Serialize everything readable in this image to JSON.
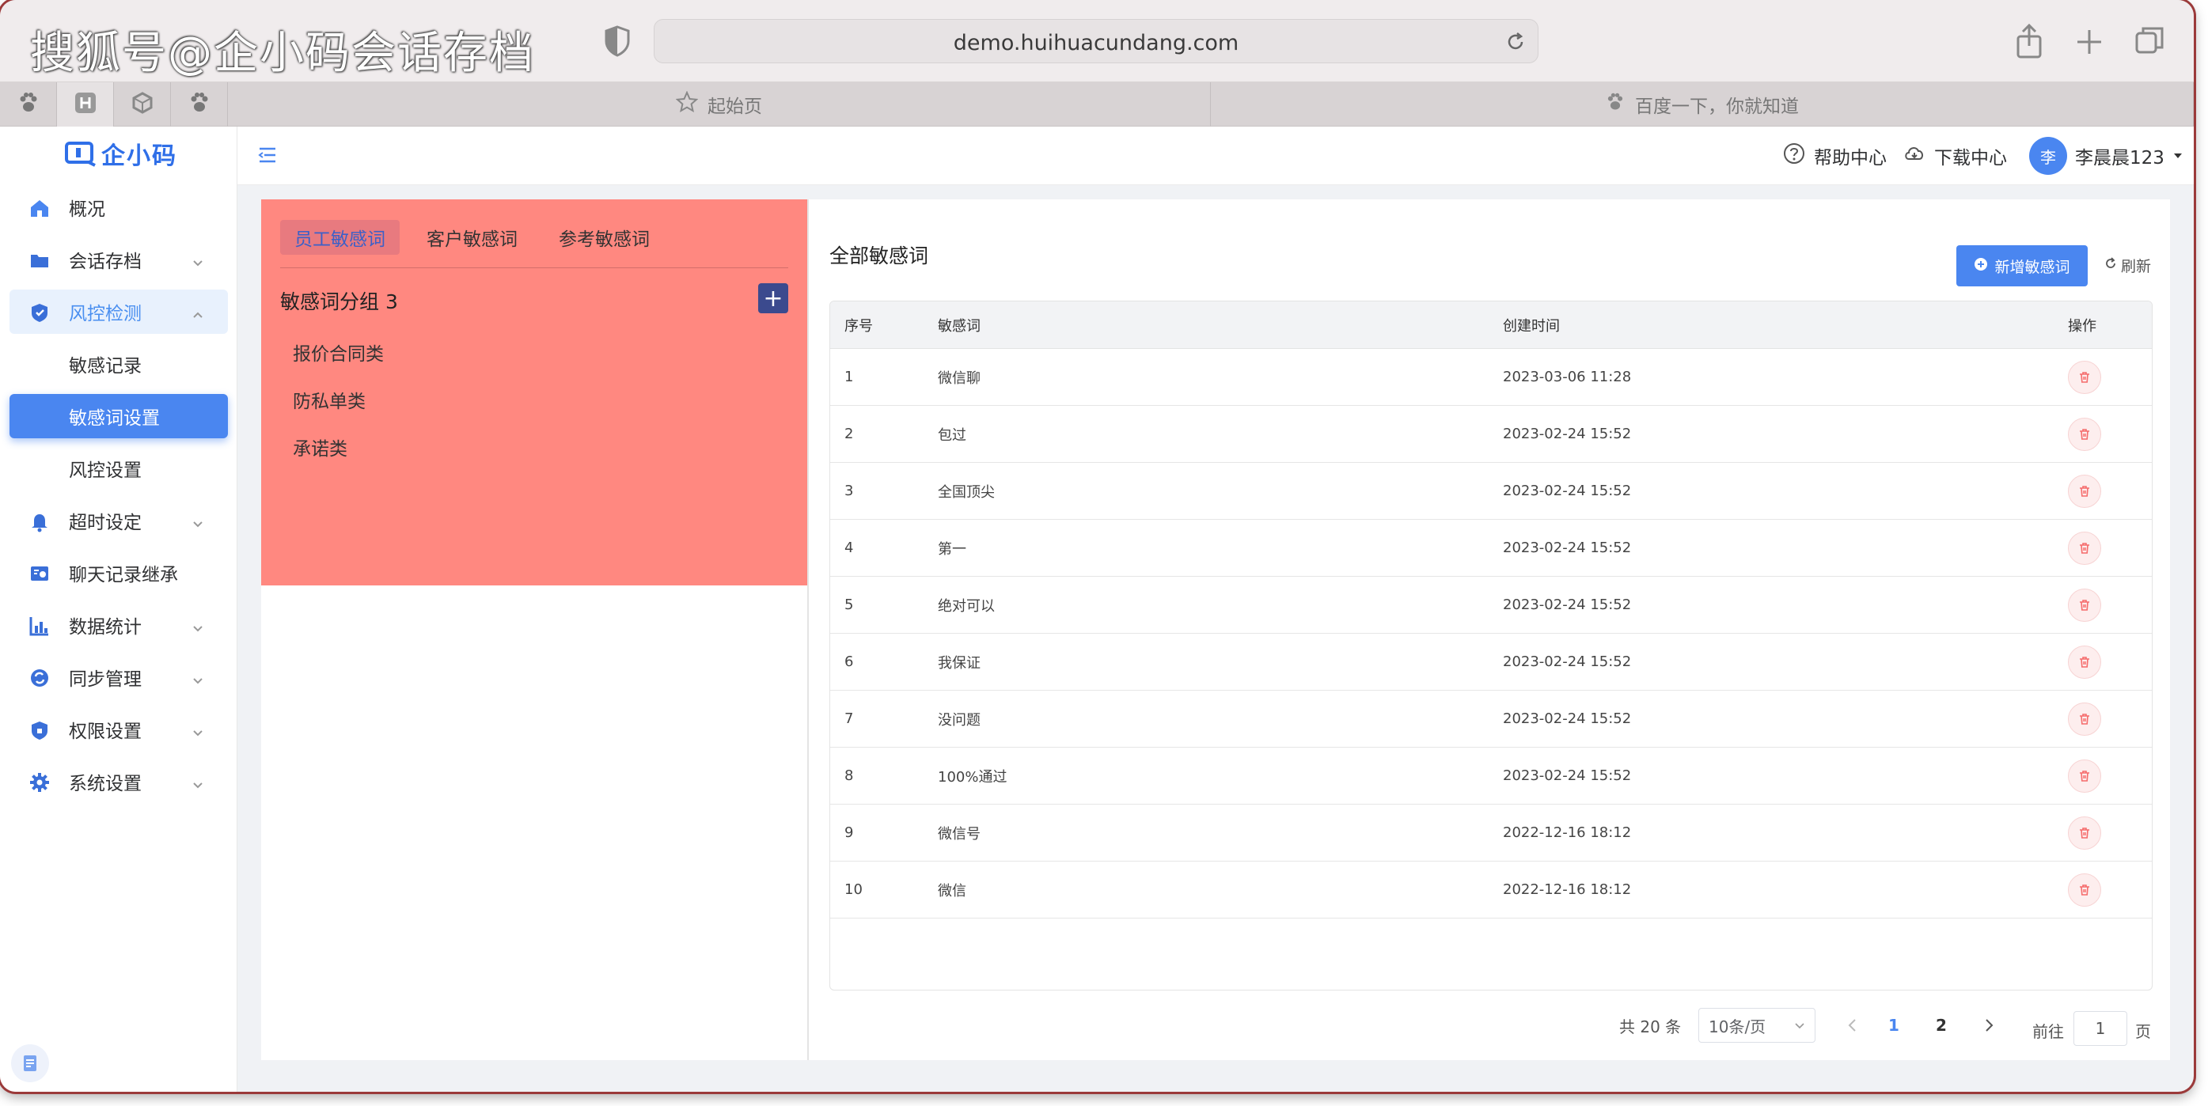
{
  "watermark": "搜狐号@企小码会话存档",
  "browser": {
    "url": "demo.huihuacundang.com",
    "tabs": [
      {
        "label": "起始页"
      },
      {
        "label": "百度一下，你就知道"
      }
    ]
  },
  "app": {
    "logo_text": "企小码",
    "sidebar": {
      "items": [
        {
          "label": "概况",
          "icon": "home-icon"
        },
        {
          "label": "会话存档",
          "icon": "folder-icon"
        },
        {
          "label": "风控检测",
          "icon": "shield-icon"
        },
        {
          "label": "敏感记录"
        },
        {
          "label": "敏感词设置"
        },
        {
          "label": "风控设置"
        },
        {
          "label": "超时设定",
          "icon": "bell-icon"
        },
        {
          "label": "聊天记录继承",
          "icon": "chat-transfer-icon"
        },
        {
          "label": "数据统计",
          "icon": "bar-chart-icon"
        },
        {
          "label": "同步管理",
          "icon": "sync-icon"
        },
        {
          "label": "权限设置",
          "icon": "lock-shield-icon"
        },
        {
          "label": "系统设置",
          "icon": "gear-icon"
        }
      ]
    },
    "header": {
      "help": "帮助中心",
      "download": "下载中心",
      "avatar_char": "李",
      "username": "李晨晨123"
    }
  },
  "left_panel": {
    "tabs": [
      "员工敏感词",
      "客户敏感词",
      "参考敏感词"
    ],
    "group_title": "敏感词分组 3",
    "add_label": "+",
    "groups": [
      "报价合同类",
      "防私单类",
      "承诺类"
    ]
  },
  "right_panel": {
    "title": "全部敏感词",
    "new_button": "新增敏感词",
    "refresh": "刷新",
    "columns": [
      "序号",
      "敏感词",
      "创建时间",
      "操作"
    ],
    "rows": [
      {
        "index": "1",
        "word": "微信聊",
        "time": "2023-03-06 11:28"
      },
      {
        "index": "2",
        "word": "包过",
        "time": "2023-02-24 15:52"
      },
      {
        "index": "3",
        "word": "全国顶尖",
        "time": "2023-02-24 15:52"
      },
      {
        "index": "4",
        "word": "第一",
        "time": "2023-02-24 15:52"
      },
      {
        "index": "5",
        "word": "绝对可以",
        "time": "2023-02-24 15:52"
      },
      {
        "index": "6",
        "word": "我保证",
        "time": "2023-02-24 15:52"
      },
      {
        "index": "7",
        "word": "没问题",
        "time": "2023-02-24 15:52"
      },
      {
        "index": "8",
        "word": "100%通过",
        "time": "2023-02-24 15:52"
      },
      {
        "index": "9",
        "word": "微信号",
        "time": "2022-12-16 18:12"
      },
      {
        "index": "10",
        "word": "微信",
        "time": "2022-12-16 18:12"
      }
    ],
    "pagination": {
      "total": "共 20 条",
      "page_size": "10条/页",
      "pages": [
        "1",
        "2"
      ],
      "current": "1",
      "goto_prefix": "前往",
      "goto_value": "1",
      "goto_suffix": "页"
    }
  },
  "colors": {
    "accent": "#4a86f0",
    "highlight_panel": "#ff8880",
    "delete": "#f56c6c"
  }
}
